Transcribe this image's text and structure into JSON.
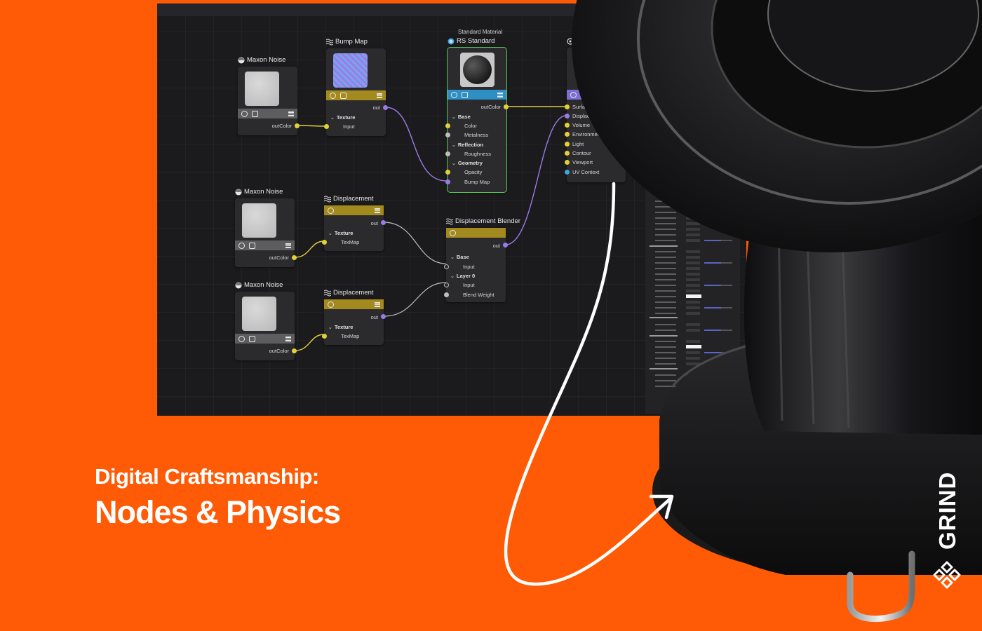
{
  "headline": {
    "line1": "Digital Craftsmanship:",
    "line2": "Nodes & Physics"
  },
  "brand": {
    "name": "GRIND",
    "logo_icon": "grind-logo-icon"
  },
  "colors": {
    "background": "#ff5a05",
    "editor_bg": "#1b1b1d",
    "node_bg": "#2b2b2d",
    "wire_yellow": "#e3cf3a",
    "wire_purple": "#9b7ae6",
    "wire_grey": "#bdbdbd"
  },
  "nodes": {
    "noise1": {
      "title": "Maxon Noise",
      "out": "outColor"
    },
    "noise2": {
      "title": "Maxon Noise",
      "out": "outColor"
    },
    "noise3": {
      "title": "Maxon Noise",
      "out": "outColor"
    },
    "bump": {
      "title": "Bump Map",
      "out": "out",
      "group": "Texture",
      "input": "Input"
    },
    "disp1": {
      "title": "Displacement",
      "out": "out",
      "group": "Texture",
      "input": "TexMap"
    },
    "disp2": {
      "title": "Displacement",
      "out": "out",
      "group": "Texture",
      "input": "TexMap"
    },
    "rs": {
      "subtitle": "Standard Material",
      "title": "RS Standard",
      "out": "outColor",
      "group_base": "Base",
      "color": "Color",
      "metalness": "Metalness",
      "group_reflection": "Reflection",
      "roughness": "Roughness",
      "group_geometry": "Geometry",
      "opacity": "Opacity",
      "bump_map": "Bump Map"
    },
    "blender": {
      "title": "Displacement Blender",
      "out": "out",
      "group_base": "Base",
      "base_input": "Input",
      "group_layer": "Layer 0",
      "layer_input": "Input",
      "blend_weight": "Blend Weight"
    },
    "output": {
      "title": "O",
      "surface": "Surface",
      "displacement": "Displacement",
      "volume": "Volume",
      "environment": "Environment",
      "light": "Light",
      "contour": "Contour",
      "viewport": "Viewport",
      "uv_context": "UV Context"
    }
  }
}
